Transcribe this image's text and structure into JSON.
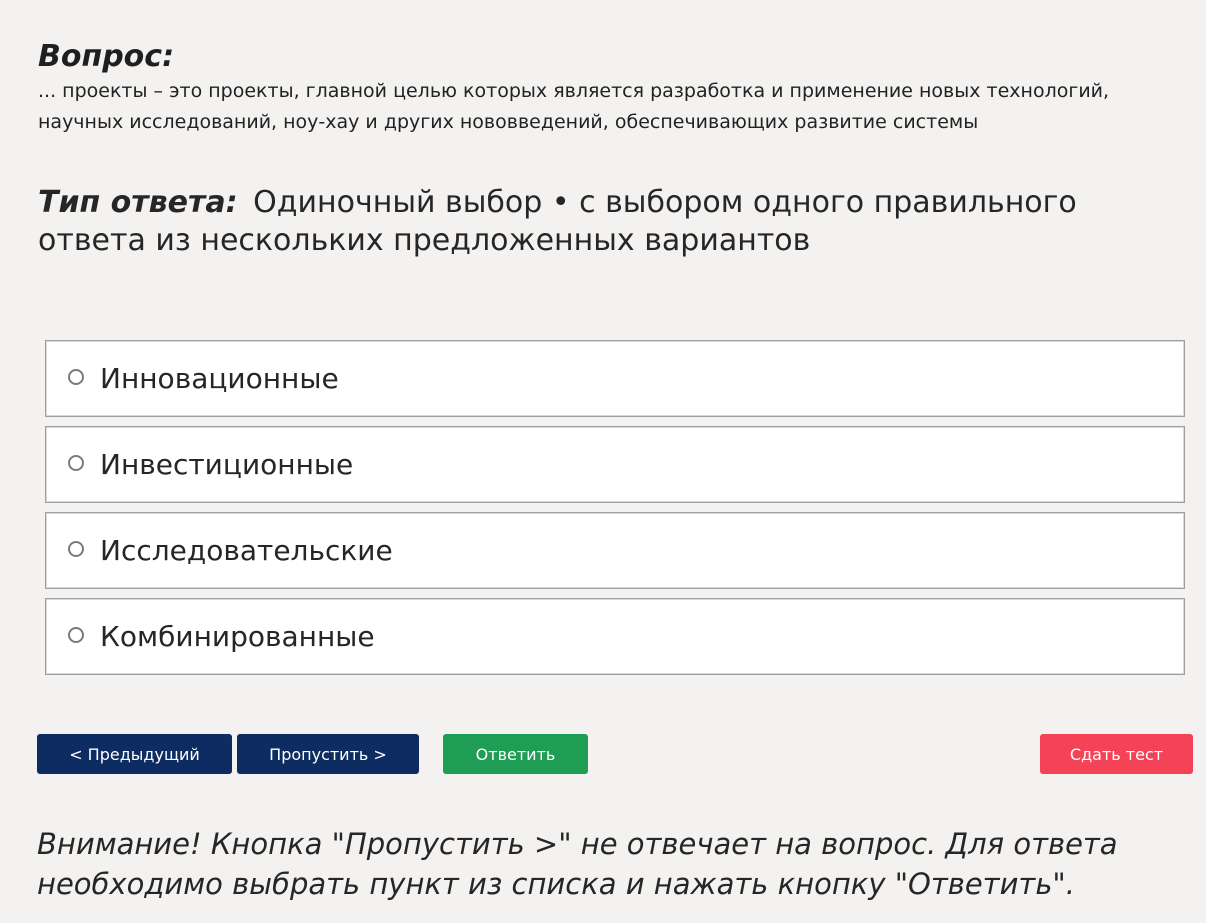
{
  "question": {
    "title": "Вопрос:",
    "text": "... проекты – это проекты, главной целью которых является разработка и применение новых технологий, научных исследований, ноу-хау и других нововведений, обеспечивающих развитие системы"
  },
  "answer_type": {
    "label": "Тип ответа:",
    "value": "Одиночный выбор • с выбором одного правильного ответа из нескольких предложенных вариантов"
  },
  "options": [
    {
      "label": "Инновационные",
      "selected": false
    },
    {
      "label": "Инвестиционные",
      "selected": false
    },
    {
      "label": "Исследовательские",
      "selected": false
    },
    {
      "label": "Комбинированные",
      "selected": false
    }
  ],
  "buttons": {
    "prev": "< Предыдущий",
    "skip": "Пропустить >",
    "answer": "Ответить",
    "finish": "Сдать тест"
  },
  "colors": {
    "primary": "#0d2d62",
    "success": "#1f9d54",
    "danger": "#f44357",
    "background": "#f3f2f0"
  },
  "notice": "Внимание! Кнопка \"Пропустить >\" не отвечает на вопрос. Для ответа необходимо выбрать пункт из списка и нажать кнопку \"Ответить\"."
}
